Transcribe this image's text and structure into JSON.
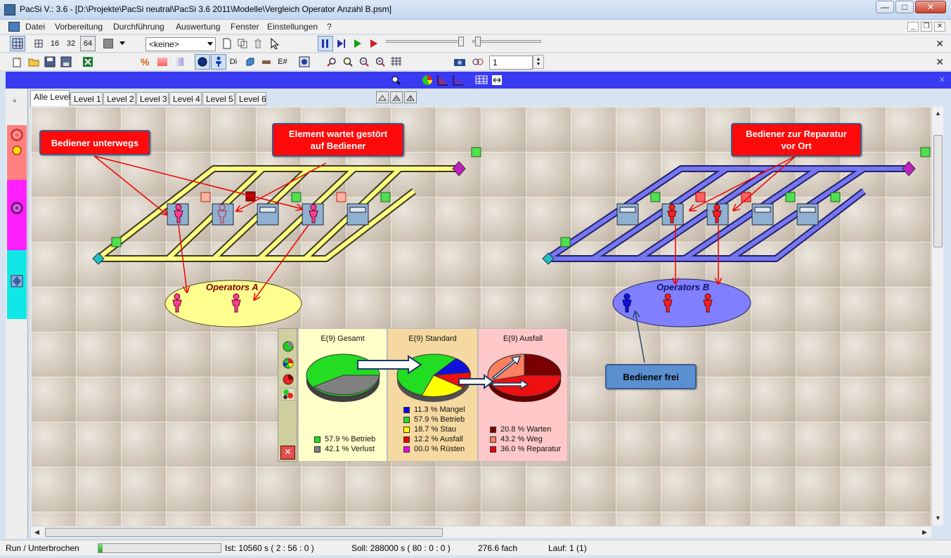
{
  "window": {
    "title": "PacSi V.: 3.6 - [D:\\Projekte\\PacSi neutral\\PacSi 3.6 2011\\Modelle\\Vergleich Operator Anzahl B.psm]"
  },
  "menu": [
    "Datei",
    "Vorbereitung",
    "Durchführung",
    "Auswertung",
    "Fenster",
    "Einstellungen",
    "?"
  ],
  "toolbar1": {
    "grid_sizes": [
      "16",
      "32",
      "64"
    ],
    "combo_value": "<keine>"
  },
  "toolbar2": {
    "label_di": "Di",
    "label_e": "E#",
    "spin_value": "1"
  },
  "tabs": [
    "Alle Level",
    "Level 1",
    "Level 2",
    "Level 3",
    "Level 4",
    "Level 5",
    "Level 6"
  ],
  "callouts": {
    "bediener_unterwegs": "Bediener unterwegs",
    "element_wartet_1": "Element wartet gestört",
    "element_wartet_2": "auf Bediener",
    "reparatur_1": "Bediener zur Reparatur",
    "reparatur_2": "vor Ort",
    "bediener_frei": "Bediener frei"
  },
  "pools": {
    "a": "Operators A",
    "b": "Operators B"
  },
  "stats": {
    "gesamt": {
      "title": "E(9) Gesamt",
      "items": [
        {
          "label": "57.9 % Betrieb",
          "color": "#22dd22"
        },
        {
          "label": "42.1 % Verlust",
          "color": "#808080"
        }
      ]
    },
    "standard": {
      "title": "E(9) Standard",
      "items": [
        {
          "label": "11.3 % Mangel",
          "color": "#0000ee"
        },
        {
          "label": "57.9 % Betrieb",
          "color": "#22dd22"
        },
        {
          "label": "18.7 % Stau",
          "color": "#ffff00"
        },
        {
          "label": "12.2 % Ausfall",
          "color": "#ee0000"
        },
        {
          "label": "00.0 % Rüsten",
          "color": "#ee00ee"
        }
      ]
    },
    "ausfall": {
      "title": "E(9) Ausfall",
      "items": [
        {
          "label": "20.8 % Warten",
          "color": "#7a0000"
        },
        {
          "label": "43.2 % Weg",
          "color": "#ff8060"
        },
        {
          "label": "36.0 % Reparatur",
          "color": "#ee0000"
        }
      ]
    }
  },
  "status": {
    "state": "Run / Unterbrochen",
    "progress": 0.037,
    "ist": "Ist: 10560  s   ( 2 : 56 : 0 )",
    "soll": "Soll: 288000  s    ( 80 : 0 : 0 )",
    "factor": "276.6 fach",
    "lauf": "Lauf: 1 (1)"
  },
  "colors": {
    "yellow_line": "#ffff80",
    "blue_line": "#6f6ff0",
    "accent_blue": "#3a3af0"
  }
}
